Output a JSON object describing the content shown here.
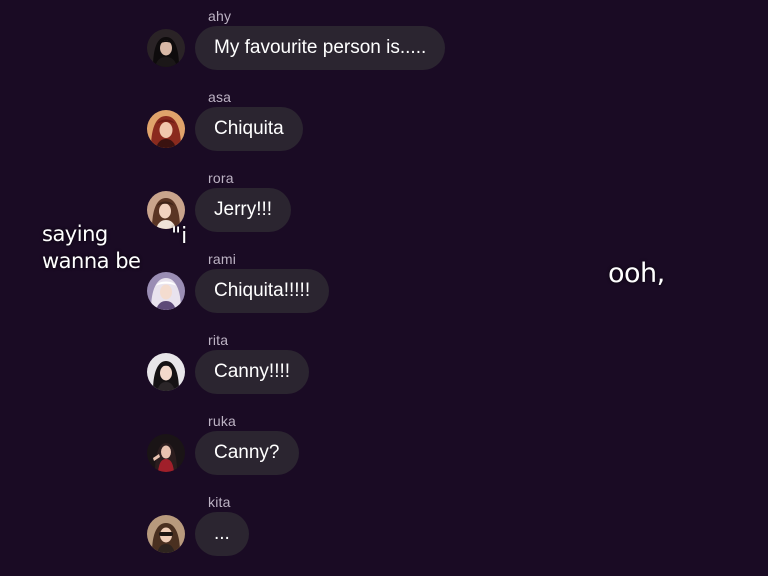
{
  "messages": [
    {
      "username": "ahy",
      "text": "My favourite person is.....",
      "avatar": "avatar-ahy"
    },
    {
      "username": "asa",
      "text": "Chiquita",
      "avatar": "avatar-asa"
    },
    {
      "username": "rora",
      "text": "Jerry!!!",
      "avatar": "avatar-rora"
    },
    {
      "username": "rami",
      "text": "Chiquita!!!!!",
      "avatar": "avatar-rami"
    },
    {
      "username": "rita",
      "text": "Canny!!!!",
      "avatar": "avatar-rita"
    },
    {
      "username": "ruka",
      "text": "Canny?",
      "avatar": "avatar-ruka"
    },
    {
      "username": "kita",
      "text": "...",
      "avatar": "avatar-kita"
    }
  ],
  "overlay": {
    "left_line_1": "saying",
    "left_line_2": "wanna be",
    "quote": "\"i",
    "right": "ooh,"
  },
  "colors": {
    "background": "#1a0b24",
    "bubble": "#2b2530",
    "username": "#bdb3c4",
    "text": "#ffffff"
  }
}
